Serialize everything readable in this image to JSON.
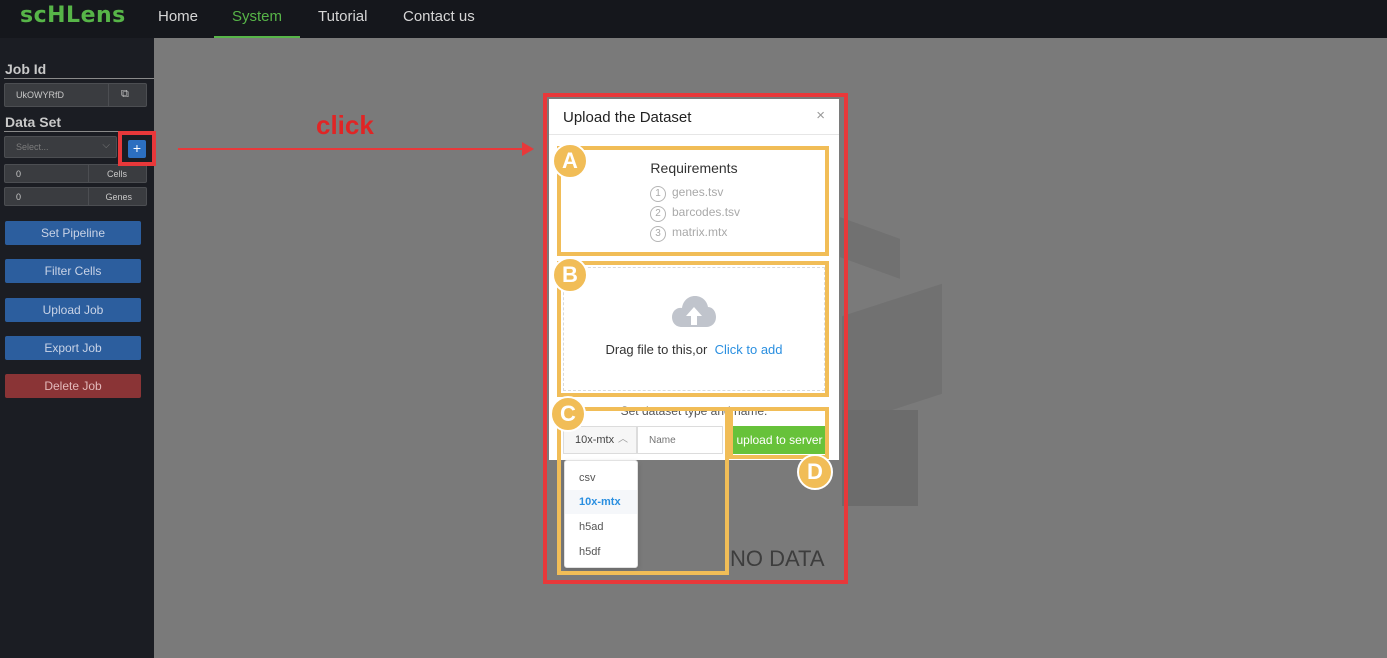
{
  "app": {
    "logo": "scHLens"
  },
  "nav": {
    "items": [
      {
        "label": "Home"
      },
      {
        "label": "System"
      },
      {
        "label": "Tutorial"
      },
      {
        "label": "Contact us"
      }
    ],
    "active": "System"
  },
  "sidebar": {
    "job_id_title": "Job Id",
    "job_id_value": "UkOWYRfD",
    "dataset_title": "Data Set",
    "dataset_placeholder": "Select...",
    "cells": {
      "value": "0",
      "label": "Cells"
    },
    "genes": {
      "value": "0",
      "label": "Genes"
    },
    "buttons": [
      {
        "label": "Set Pipeline"
      },
      {
        "label": "Filter Cells"
      },
      {
        "label": "Upload Job"
      },
      {
        "label": "Export Job"
      },
      {
        "label": "Delete Job"
      }
    ]
  },
  "annotation": {
    "click_label": "click",
    "badges": [
      "A",
      "B",
      "C",
      "D"
    ],
    "highlight_color": "#e8383a",
    "badge_color": "#f1bd57"
  },
  "main": {
    "empty_text": "NO DATA"
  },
  "modal": {
    "title": "Upload the Dataset",
    "close": "×",
    "requirements_title": "Requirements",
    "requirements": [
      {
        "num": "1",
        "file": "genes.tsv"
      },
      {
        "num": "2",
        "file": "barcodes.tsv"
      },
      {
        "num": "3",
        "file": "matrix.mtx"
      }
    ],
    "drop_text": "Drag file to this,or",
    "drop_link": "Click to add",
    "set_label": "Set dataset type and name:",
    "type_value": "10x-mtx",
    "name_placeholder": "Name",
    "upload_button": "upload to server",
    "type_options": [
      "csv",
      "10x-mtx",
      "h5ad",
      "h5df"
    ],
    "selected_option": "10x-mtx"
  }
}
